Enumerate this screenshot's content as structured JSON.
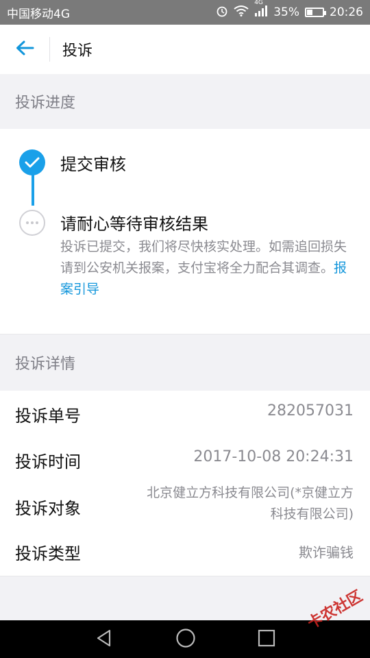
{
  "status_bar": {
    "carrier": "中国移动4G",
    "network": "4G",
    "battery": "35%",
    "time": "20:26"
  },
  "nav": {
    "title": "投诉"
  },
  "progress": {
    "header": "投诉进度",
    "steps": [
      {
        "title": "提交审核",
        "state": "done"
      },
      {
        "title": "请耐心等待审核结果",
        "state": "pending"
      }
    ],
    "description": "投诉已提交，我们将尽快核实处理。如需追回损失请到公安机关报案，支付宝将全力配合其调查。",
    "link_text": "报案引导"
  },
  "details": {
    "header": "投诉详情",
    "rows": [
      {
        "label": "投诉单号",
        "value": "282057031"
      },
      {
        "label": "投诉时间",
        "value": "2017-10-08 20:24:31"
      },
      {
        "label": "投诉对象",
        "value_line1": "北京健立方科技有限公司(*京健立方",
        "value_line2": "科技有限公司)"
      },
      {
        "label": "投诉类型",
        "value": "欺诈骗钱"
      }
    ]
  },
  "watermark": "卡农社区",
  "colors": {
    "accent": "#1aa0e9",
    "link": "#1296db",
    "status_bar": "#7a7a7a"
  }
}
